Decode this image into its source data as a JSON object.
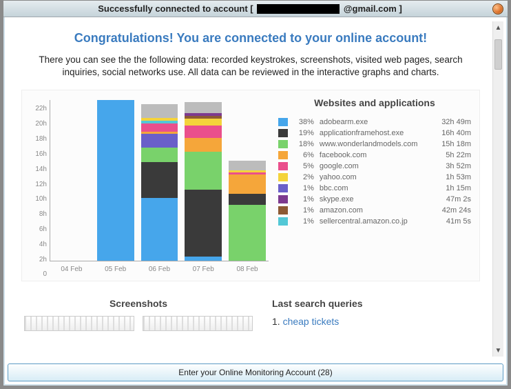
{
  "titlebar": {
    "text_prefix": "Successfully connected to account  [",
    "email_suffix": "@gmail.com ]"
  },
  "heading": "Congratulations! You are connected to your online account!",
  "subtext": "There you can see the the following data: recorded keystrokes, screenshots, visited web pages, search inquiries, social networks use. All data can be reviewed in the interactive graphs and charts.",
  "legend_title": "Websites and applications",
  "colors": {
    "adobearm": "#46a6eb",
    "appframe": "#3a3a3a",
    "wonderland": "#79d26b",
    "facebook": "#f5a63a",
    "google": "#ea4f8c",
    "yahoo": "#f4d33b",
    "bbc": "#6a5fc9",
    "skype": "#7d3a8f",
    "amazon": "#8d5a34",
    "seller": "#53c8d6",
    "other": "#bcbcbc"
  },
  "legend": [
    {
      "pct": "38%",
      "name": "adobearm.exe",
      "dur": "32h 49m",
      "color": "adobearm"
    },
    {
      "pct": "19%",
      "name": "applicationframehost.exe",
      "dur": "16h 40m",
      "color": "appframe"
    },
    {
      "pct": "18%",
      "name": "www.wonderlandmodels.com",
      "dur": "15h 18m",
      "color": "wonderland"
    },
    {
      "pct": "6%",
      "name": "facebook.com",
      "dur": "5h 22m",
      "color": "facebook"
    },
    {
      "pct": "5%",
      "name": "google.com",
      "dur": "3h 52m",
      "color": "google"
    },
    {
      "pct": "2%",
      "name": "yahoo.com",
      "dur": "1h 53m",
      "color": "yahoo"
    },
    {
      "pct": "1%",
      "name": "bbc.com",
      "dur": "1h 15m",
      "color": "bbc"
    },
    {
      "pct": "1%",
      "name": "skype.exe",
      "dur": "47m 2s",
      "color": "skype"
    },
    {
      "pct": "1%",
      "name": "amazon.com",
      "dur": "42m 24s",
      "color": "amazon"
    },
    {
      "pct": "1%",
      "name": "sellercentral.amazon.co.jp",
      "dur": "41m 5s",
      "color": "seller"
    }
  ],
  "chart_data": {
    "type": "bar",
    "stacked": true,
    "ylabel": "hours",
    "ylim": [
      0,
      23
    ],
    "y_ticks": [
      "22h",
      "20h",
      "18h",
      "16h",
      "14h",
      "12h",
      "10h",
      "8h",
      "6h",
      "4h",
      "2h",
      "0"
    ],
    "categories": [
      "04 Feb",
      "05 Feb",
      "06 Feb",
      "07 Feb",
      "08 Feb"
    ],
    "series_colors": {
      "adobearm": "#46a6eb",
      "appframe": "#3a3a3a",
      "wonderland": "#79d26b",
      "facebook": "#f5a63a",
      "google": "#ea4f8c",
      "yahoo": "#f4d33b",
      "bbc": "#6a5fc9",
      "skype": "#7d3a8f",
      "amazon": "#8d5a34",
      "seller": "#53c8d6",
      "other": "#bcbcbc"
    },
    "data": [
      {
        "category": "04 Feb",
        "stacks": []
      },
      {
        "category": "05 Feb",
        "stacks": [
          {
            "k": "adobearm",
            "h": 23.0
          }
        ]
      },
      {
        "category": "06 Feb",
        "stacks": [
          {
            "k": "adobearm",
            "h": 9.0
          },
          {
            "k": "appframe",
            "h": 5.2
          },
          {
            "k": "wonderland",
            "h": 2.0
          },
          {
            "k": "bbc",
            "h": 2.0
          },
          {
            "k": "facebook",
            "h": 0.3
          },
          {
            "k": "google",
            "h": 1.2
          },
          {
            "k": "seller",
            "h": 0.4
          },
          {
            "k": "yahoo",
            "h": 0.4
          },
          {
            "k": "other",
            "h": 2.0
          }
        ]
      },
      {
        "category": "07 Feb",
        "stacks": [
          {
            "k": "adobearm",
            "h": 0.6
          },
          {
            "k": "appframe",
            "h": 9.6
          },
          {
            "k": "wonderland",
            "h": 5.4
          },
          {
            "k": "facebook",
            "h": 2.0
          },
          {
            "k": "google",
            "h": 1.8
          },
          {
            "k": "yahoo",
            "h": 1.0
          },
          {
            "k": "amazon",
            "h": 0.4
          },
          {
            "k": "skype",
            "h": 0.4
          },
          {
            "k": "other",
            "h": 1.6
          }
        ]
      },
      {
        "category": "08 Feb",
        "stacks": [
          {
            "k": "wonderland",
            "h": 8.0
          },
          {
            "k": "appframe",
            "h": 1.6
          },
          {
            "k": "facebook",
            "h": 2.8
          },
          {
            "k": "google",
            "h": 0.3
          },
          {
            "k": "yahoo",
            "h": 0.3
          },
          {
            "k": "other",
            "h": 1.4
          }
        ]
      }
    ]
  },
  "screenshots_title": "Screenshots",
  "queries_title": "Last search queries",
  "queries": [
    {
      "n": "1.",
      "text": "cheap tickets"
    }
  ],
  "footer_button": "Enter your Online Monitoring Account (28)"
}
